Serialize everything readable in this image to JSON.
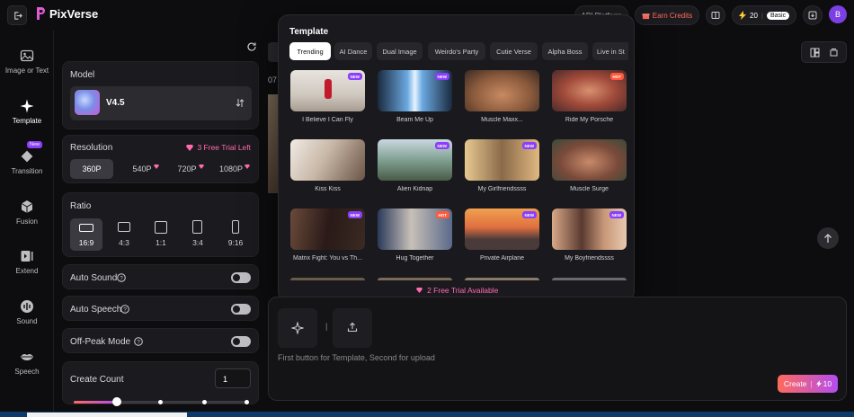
{
  "app": {
    "title": "PixVerse"
  },
  "header": {
    "api_label": "API Platform",
    "earn_label": "Earn Credits",
    "credits_value": "20",
    "plan_label": "Basic",
    "avatar_letter": "B"
  },
  "rail": {
    "items": [
      {
        "label": "Image or Text",
        "icon": "image-icon"
      },
      {
        "label": "Template",
        "icon": "sparkle-icon",
        "active": true
      },
      {
        "label": "Transition",
        "icon": "diamond-icon",
        "badge": "New"
      },
      {
        "label": "Fusion",
        "icon": "cube-icon"
      },
      {
        "label": "Extend",
        "icon": "extend-icon"
      },
      {
        "label": "Sound",
        "icon": "waveform-icon"
      },
      {
        "label": "Speech",
        "icon": "lips-icon"
      }
    ]
  },
  "settings": {
    "model_title": "Model",
    "model_value": "V4.5",
    "resolution_title": "Resolution",
    "free_trial_left": "3 Free Trial Left",
    "resolutions": [
      "360P",
      "540P",
      "720P",
      "1080P"
    ],
    "ratio_title": "Ratio",
    "ratios": [
      "16:9",
      "4:3",
      "1:1",
      "3:4",
      "9:16"
    ],
    "auto_sound": "Auto Sound",
    "auto_speech": "Auto Speech",
    "off_peak": "Off-Peak Mode",
    "create_count_label": "Create Count",
    "create_count_value": "1"
  },
  "popup": {
    "title": "Template",
    "tabs": [
      "Trending",
      "AI Dance",
      "Dual Image",
      "Weirdo's Party",
      "Cutie Verse",
      "Alpha Boss",
      "Live in St"
    ],
    "templates": [
      {
        "name": "I Believe I Can Fly",
        "badge": "NEW"
      },
      {
        "name": "Beam Me Up",
        "badge": "NEW"
      },
      {
        "name": "Muscle Maxx...",
        "badge": ""
      },
      {
        "name": "Ride My Porsche",
        "badge": "HOT"
      },
      {
        "name": "Kiss Kiss",
        "badge": ""
      },
      {
        "name": "Alien Kidnap",
        "badge": "NEW"
      },
      {
        "name": "My Girlfriendssss",
        "badge": "NEW"
      },
      {
        "name": "Muscle Surge",
        "badge": ""
      },
      {
        "name": "Matrix Fight: You vs Th...",
        "badge": "NEW"
      },
      {
        "name": "Hug Together",
        "badge": "HOT"
      },
      {
        "name": "Private Airplane",
        "badge": "NEW"
      },
      {
        "name": "My Boyfriendssss",
        "badge": "NEW"
      }
    ],
    "trial_available": "2 Free Trial Available"
  },
  "prompt": {
    "hint": "First button for Template, Second for upload",
    "create_label": "Create",
    "create_cost": "10"
  },
  "misc": {
    "behind_label": "07"
  },
  "colors": {
    "accent": "#7b3fe4",
    "badge_new": "#8a3ffc",
    "badge_hot": "#ff5a3c",
    "create_gradient_start": "#ff6a5c",
    "create_gradient_end": "#b44cf0"
  }
}
